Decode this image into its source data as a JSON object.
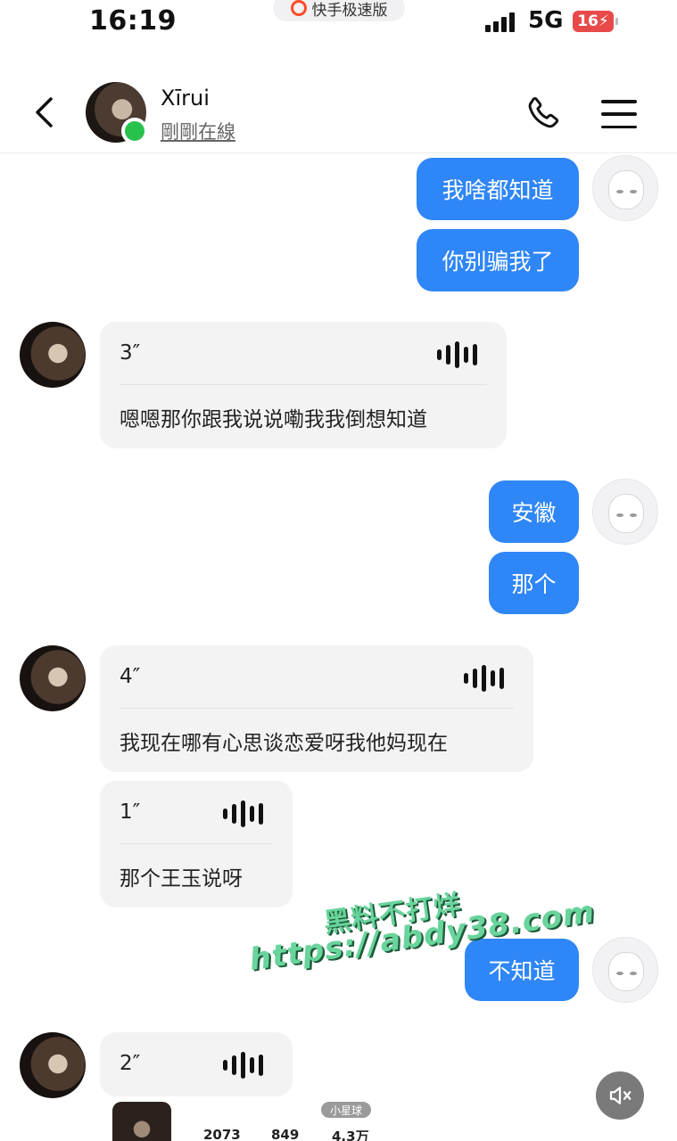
{
  "status_bar": {
    "time": "16:19",
    "network": "5G",
    "battery": "16",
    "app_pill": "快手极速版"
  },
  "header": {
    "contact_name": "Xīrui",
    "contact_status": "剛剛在線"
  },
  "messages": [
    {
      "from": "me",
      "text": "我啥都知道"
    },
    {
      "from": "me",
      "text": "你别骗我了"
    },
    {
      "from": "other",
      "type": "voice",
      "duration": "3″",
      "transcript": "嗯嗯那你跟我说说嘞我我倒想知道"
    },
    {
      "from": "me",
      "text": "安徽"
    },
    {
      "from": "me",
      "text": "那个"
    },
    {
      "from": "other",
      "type": "voice",
      "duration": "4″",
      "transcript": "我现在哪有心思谈恋爱呀我他妈现在"
    },
    {
      "from": "other",
      "type": "voice",
      "duration": "1″",
      "transcript": "那个王玉说呀"
    },
    {
      "from": "me",
      "text": "不知道"
    },
    {
      "from": "other",
      "type": "voice",
      "duration": "2″",
      "transcript": ""
    }
  ],
  "watermark": {
    "line1": "黑料不打烊",
    "line2": "https://abdy38.com"
  },
  "peek_card": {
    "tag": "小星球",
    "stats": [
      "2073",
      "849",
      "4.3万"
    ]
  },
  "colors": {
    "my_bubble": "#2f86f6",
    "voice_bubble": "#f3f3f3",
    "online": "#27c24c"
  }
}
